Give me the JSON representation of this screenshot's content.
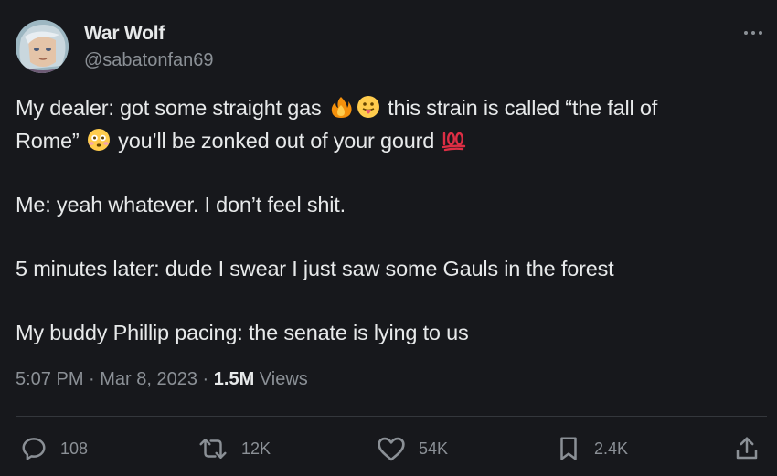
{
  "author": {
    "display_name": "War Wolf",
    "handle": "@sabatonfan69"
  },
  "tweet": {
    "line1_a": "My dealer: got some straight gas ",
    "line1_emoji1": "fire-emoji",
    "line1_emoji2": "tongue-out-emoji",
    "line1_b": " this strain is called “the fall of",
    "line2_a": "Rome” ",
    "line2_emoji": "flushed-emoji",
    "line2_b": " you’ll be zonked out of your gourd ",
    "line2_emoji2": "hundred-points-emoji",
    "para2": "Me: yeah whatever. I don’t feel shit.",
    "para3": "5 minutes later: dude I swear I just saw some Gauls in the forest",
    "para4": "My buddy Phillip pacing: the senate is lying to us"
  },
  "meta": {
    "time": "5:07 PM",
    "sep1": " · ",
    "date": "Mar 8, 2023",
    "sep2": " · ",
    "views_count": "1.5M",
    "views_label": " Views"
  },
  "actions": {
    "replies": "108",
    "retweets": "12K",
    "likes": "54K",
    "bookmarks": "2.4K"
  },
  "colors": {
    "background": "#17181c",
    "text_primary": "#e7e9ea",
    "text_secondary": "#8b9096",
    "divider": "#34373c"
  }
}
